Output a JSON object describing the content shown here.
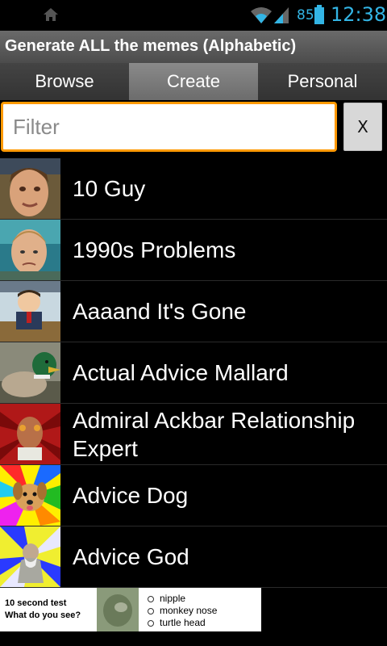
{
  "status_bar": {
    "battery_percent": "85",
    "time": "12:38",
    "accent_color": "#33b5e5"
  },
  "title_bar": {
    "title": "Generate ALL the memes (Alphabetic)"
  },
  "tabs": [
    {
      "label": "Browse",
      "active": false
    },
    {
      "label": "Create",
      "active": true
    },
    {
      "label": "Personal",
      "active": false
    }
  ],
  "filter": {
    "placeholder": "Filter",
    "value": "",
    "clear_label": "X",
    "focus_color": "#ff9900"
  },
  "memes": [
    {
      "label": "10 Guy",
      "icon": "10-guy-thumbnail"
    },
    {
      "label": "1990s Problems",
      "icon": "1990s-problems-thumbnail"
    },
    {
      "label": "Aaaand It's Gone",
      "icon": "aaaand-its-gone-thumbnail"
    },
    {
      "label": "Actual Advice Mallard",
      "icon": "actual-advice-mallard-thumbnail"
    },
    {
      "label": "Admiral Ackbar Relationship Expert",
      "icon": "admiral-ackbar-thumbnail"
    },
    {
      "label": "Advice Dog",
      "icon": "advice-dog-thumbnail"
    },
    {
      "label": "Advice God",
      "icon": "advice-god-thumbnail"
    }
  ],
  "ad": {
    "line1": "10 second test",
    "line2": "What do you see?",
    "options": [
      "nipple",
      "monkey nose",
      "turtle head"
    ]
  }
}
